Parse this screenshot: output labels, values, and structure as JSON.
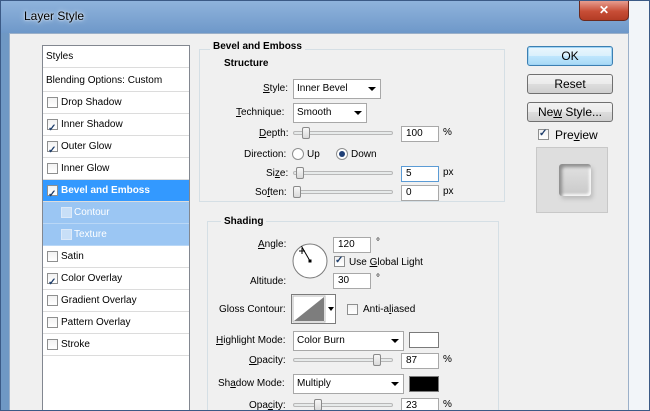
{
  "window": {
    "title": "Layer Style",
    "close_glyph": "✕"
  },
  "style_list": {
    "header": "Styles",
    "items": [
      {
        "label": "Blending Options: Custom",
        "checkbox": false,
        "checked": false,
        "selected": false,
        "sub": false
      },
      {
        "label": "Drop Shadow",
        "checkbox": true,
        "checked": false,
        "selected": false,
        "sub": false
      },
      {
        "label": "Inner Shadow",
        "checkbox": true,
        "checked": true,
        "selected": false,
        "sub": false
      },
      {
        "label": "Outer Glow",
        "checkbox": true,
        "checked": true,
        "selected": false,
        "sub": false
      },
      {
        "label": "Inner Glow",
        "checkbox": true,
        "checked": false,
        "selected": false,
        "sub": false
      },
      {
        "label": "Bevel and Emboss",
        "checkbox": true,
        "checked": true,
        "selected": true,
        "sub": false
      },
      {
        "label": "Contour",
        "checkbox": true,
        "checked": false,
        "selected": false,
        "sub": true
      },
      {
        "label": "Texture",
        "checkbox": true,
        "checked": false,
        "selected": false,
        "sub": true
      },
      {
        "label": "Satin",
        "checkbox": true,
        "checked": false,
        "selected": false,
        "sub": false
      },
      {
        "label": "Color Overlay",
        "checkbox": true,
        "checked": true,
        "selected": false,
        "sub": false
      },
      {
        "label": "Gradient Overlay",
        "checkbox": true,
        "checked": false,
        "selected": false,
        "sub": false
      },
      {
        "label": "Pattern Overlay",
        "checkbox": true,
        "checked": false,
        "selected": false,
        "sub": false
      },
      {
        "label": "Stroke",
        "checkbox": true,
        "checked": false,
        "selected": false,
        "sub": false
      }
    ]
  },
  "bevel": {
    "section_title": "Bevel and Emboss",
    "structure_title": "Structure",
    "style": {
      "label_pre": "",
      "label_u": "S",
      "label_post": "tyle:",
      "value": "Inner Bevel"
    },
    "technique": {
      "label_pre": "",
      "label_u": "T",
      "label_post": "echnique:",
      "value": "Smooth"
    },
    "depth": {
      "label_pre": "",
      "label_u": "D",
      "label_post": "epth:",
      "value": "100",
      "unit": "%",
      "level_percent": 10
    },
    "direction": {
      "label": "Direction:",
      "up_label": "Up",
      "down_label": "Down",
      "selected": "Down"
    },
    "size": {
      "label_pre": "Si",
      "label_u": "z",
      "label_post": "e:",
      "value": "5",
      "unit": "px",
      "level_percent": 3
    },
    "soften": {
      "label_pre": "So",
      "label_u": "f",
      "label_post": "ten:",
      "value": "0",
      "unit": "px",
      "level_percent": 0
    }
  },
  "shading": {
    "title": "Shading",
    "angle": {
      "label_pre": "",
      "label_u": "A",
      "label_post": "ngle:",
      "value": "120",
      "unit": "°"
    },
    "use_global_light": {
      "label_pre": "Use ",
      "label_u": "G",
      "label_post": "lobal Light",
      "checked": true
    },
    "altitude": {
      "label": "Altitude:",
      "value": "30",
      "unit": "°"
    },
    "gloss_contour": {
      "label": "Gloss Contour:"
    },
    "anti_aliased": {
      "label_pre": "Anti-a",
      "label_u": "l",
      "label_post": "iased",
      "checked": false
    },
    "highlight_mode": {
      "label_pre": "",
      "label_u": "H",
      "label_post": "ighlight Mode:",
      "value": "Color Burn",
      "color": "#ffffff"
    },
    "highlight_opacity": {
      "label_pre": "",
      "label_u": "O",
      "label_post": "pacity:",
      "value": "87",
      "unit": "%",
      "level_percent": 87
    },
    "shadow_mode": {
      "label_pre": "Sh",
      "label_u": "a",
      "label_post": "dow Mode:",
      "value": "Multiply",
      "color": "#000000"
    },
    "shadow_opacity": {
      "label_pre": "Opa",
      "label_u": "c",
      "label_post": "ity:",
      "value": "23",
      "unit": "%",
      "level_percent": 23
    }
  },
  "buttons": {
    "ok": "OK",
    "reset": "Reset",
    "new_style_pre": "Ne",
    "new_style_u": "w",
    "new_style_post": " Style...",
    "preview_pre": "Pre",
    "preview_u": "v",
    "preview_post": "iew",
    "preview_checked": true
  }
}
